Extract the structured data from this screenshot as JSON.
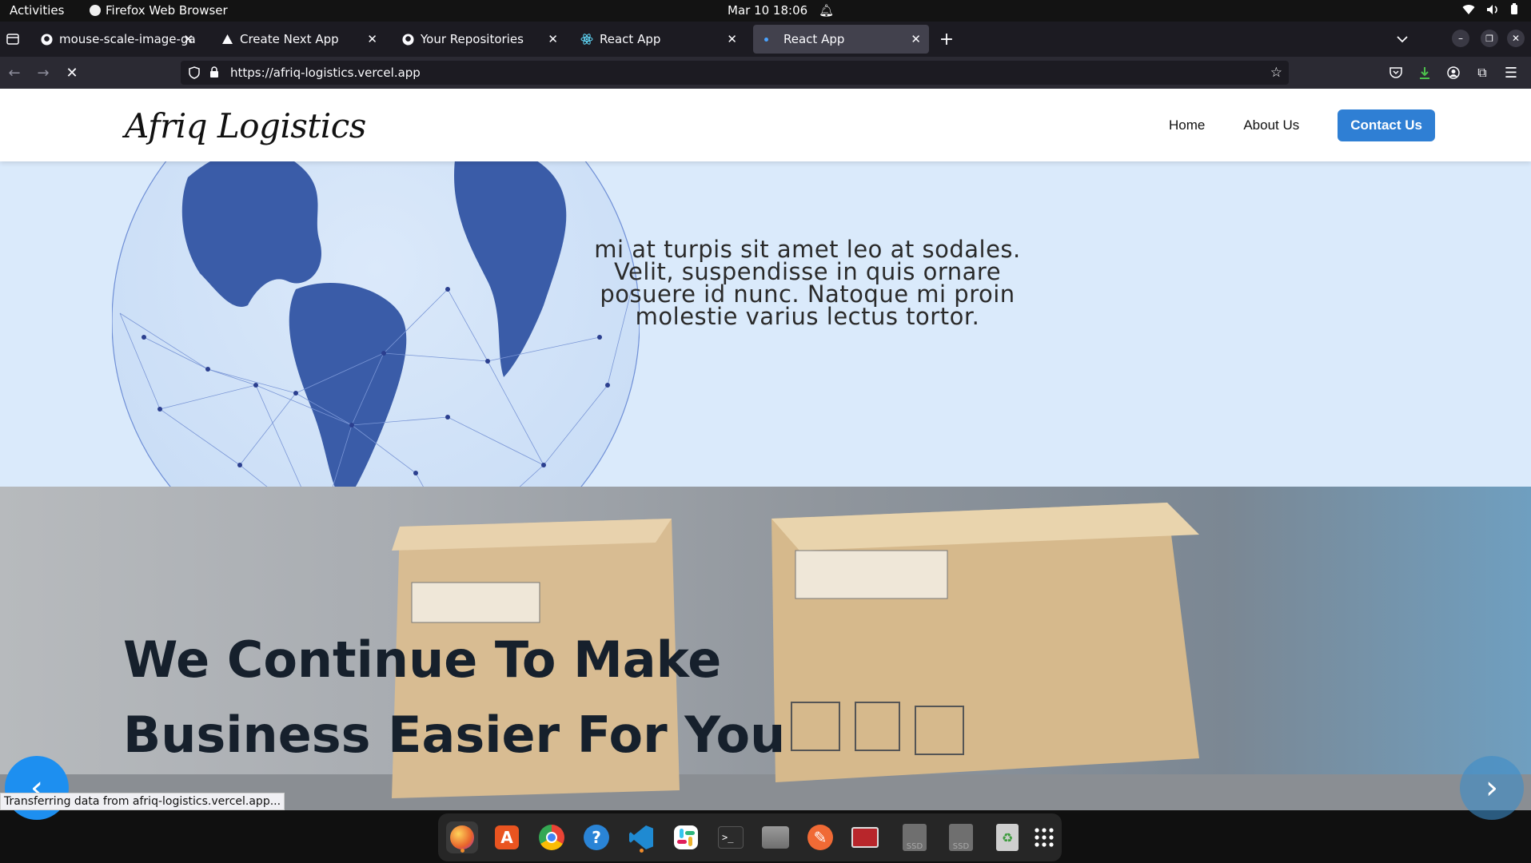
{
  "system_bar": {
    "activities": "Activities",
    "app_name": "Firefox Web Browser",
    "date_time": "Mar 10  18:06"
  },
  "tabs": [
    {
      "title": "mouse-scale-image-galle",
      "icon": "github-icon",
      "active": false
    },
    {
      "title": "Create Next App",
      "icon": "vercel-icon",
      "active": false
    },
    {
      "title": "Your Repositories",
      "icon": "github-icon",
      "active": false
    },
    {
      "title": "React App",
      "icon": "react-icon",
      "active": false
    },
    {
      "title": "React App",
      "icon": "react-icon",
      "active": true
    }
  ],
  "url": "https://afriq-logistics.vercel.app",
  "site": {
    "brand": "Afriq Logistics",
    "nav": {
      "home": "Home",
      "about": "About Us",
      "contact": "Contact Us"
    },
    "hero_text": "mi at turpis sit amet leo at sodales. Velit, suspendisse in quis ornare posuere id nunc. Natoque mi proin molestie varius lectus tortor.",
    "banner_heading_line1": "We Continue To Make",
    "banner_heading_line2": "Business Easier For You"
  },
  "status_text": "Transferring data from afriq-logistics.vercel.app...",
  "dock": [
    {
      "name": "firefox-icon",
      "color": "#e8632b"
    },
    {
      "name": "app-store-icon",
      "color": "#e95420"
    },
    {
      "name": "chrome-icon",
      "color": "#4285f4"
    },
    {
      "name": "help-icon",
      "color": "#2a84d6"
    },
    {
      "name": "vscode-icon",
      "color": "#1f8ad2"
    },
    {
      "name": "slack-icon",
      "color": "#ffffff"
    },
    {
      "name": "terminal-icon",
      "color": "#2b2b2b"
    },
    {
      "name": "files-icon",
      "color": "#787878"
    },
    {
      "name": "draw-icon",
      "color": "#f06a35"
    },
    {
      "name": "screen-recorder-icon",
      "color": "#b8262b"
    },
    {
      "name": "ssd-drive-icon",
      "color": "#6f6f6f"
    },
    {
      "name": "ssd-drive-icon",
      "color": "#6f6f6f"
    },
    {
      "name": "trash-icon",
      "color": "#cfcfcf"
    },
    {
      "name": "app-grid-icon",
      "color": "#ffffff"
    }
  ],
  "dock_labels": {
    "ssd1": "SSD",
    "ssd2": "SSD"
  }
}
